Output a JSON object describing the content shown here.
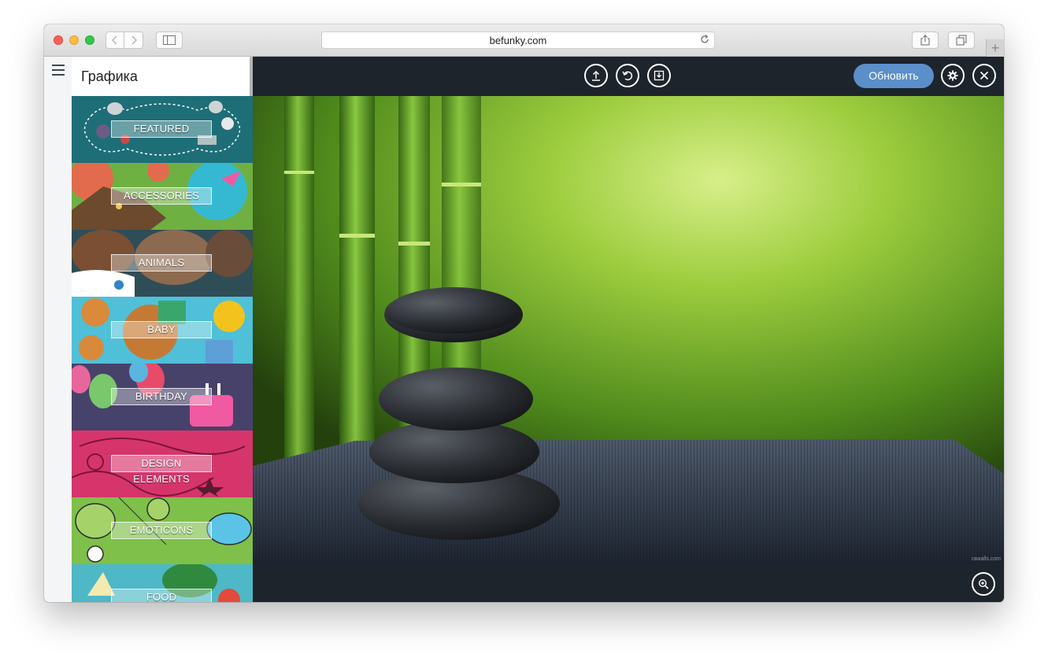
{
  "browser": {
    "url": "befunky.com"
  },
  "panel": {
    "title": "Графика",
    "categories": [
      {
        "label": "FEATURED"
      },
      {
        "label": "ACCESSORIES"
      },
      {
        "label": "ANIMALS"
      },
      {
        "label": "BABY"
      },
      {
        "label": "BIRTHDAY"
      },
      {
        "label": "DESIGN ELEMENTS"
      },
      {
        "label": "EMOTICONS"
      },
      {
        "label": "FOOD"
      }
    ]
  },
  "editor": {
    "update_label": "Обновить",
    "watermark": "rawalls.com"
  },
  "colors": {
    "accent": "#5b8fc9",
    "editor_bg": "#1e242c"
  },
  "icons": [
    "hamburger-icon",
    "upload-icon",
    "undo-icon",
    "save-icon",
    "gear-icon",
    "close-icon",
    "zoom-icon",
    "share-icon",
    "tabs-icon",
    "reload-icon"
  ]
}
